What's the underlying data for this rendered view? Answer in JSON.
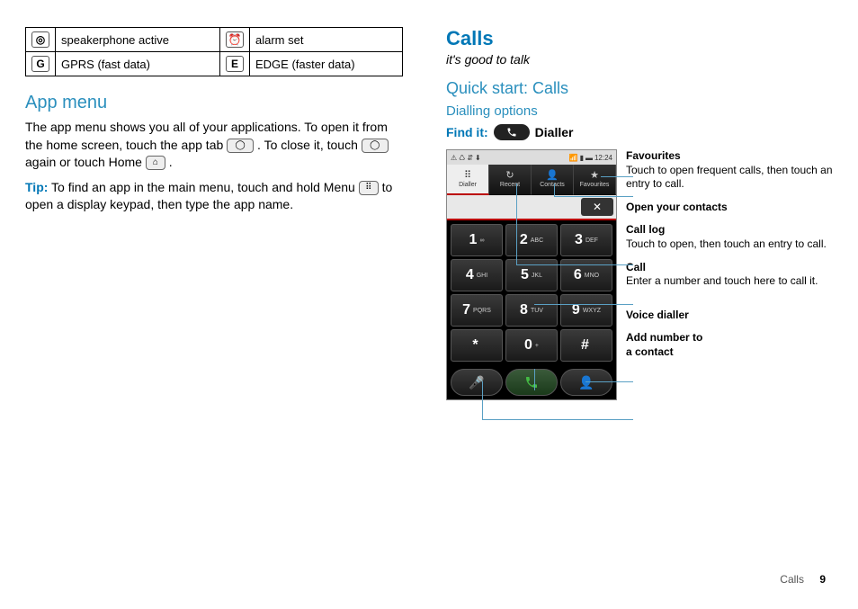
{
  "icon_table": {
    "rows": [
      {
        "icon1": "◎",
        "label1": "speakerphone active",
        "icon2": "⏰",
        "label2": "alarm set"
      },
      {
        "icon1": "G",
        "label1": "GPRS (fast data)",
        "icon2": "E",
        "label2": "EDGE (faster data)"
      }
    ]
  },
  "left": {
    "app_menu_title": "App menu",
    "app_menu_p1a": "The app menu shows you all of your applications. To open it from the home screen, touch the app tab ",
    "app_menu_p1b": ". To close it, touch ",
    "app_menu_p1c": " again or touch Home ",
    "app_menu_p1d": ".",
    "tip_label": "Tip:",
    "tip_text_a": " To find an app in the main menu, touch and hold Menu ",
    "tip_text_b": " to open a display keypad, then type the app name."
  },
  "right": {
    "calls_title": "Calls",
    "tagline": "it's good to talk",
    "quickstart": "Quick start: Calls",
    "dialling_options": "Dialling options",
    "find_it_label": "Find it:",
    "find_it_value": "Dialler",
    "status_time": "12:24",
    "tabs": [
      "Dialler",
      "Recent",
      "Contacts",
      "Favourites"
    ],
    "keys": [
      {
        "n": "1",
        "l": "∞"
      },
      {
        "n": "2",
        "l": "ABC"
      },
      {
        "n": "3",
        "l": "DEF"
      },
      {
        "n": "4",
        "l": "GHI"
      },
      {
        "n": "5",
        "l": "JKL"
      },
      {
        "n": "6",
        "l": "MNO"
      },
      {
        "n": "7",
        "l": "PQRS"
      },
      {
        "n": "8",
        "l": "TUV"
      },
      {
        "n": "9",
        "l": "WXYZ"
      },
      {
        "n": "*",
        "l": ""
      },
      {
        "n": "0",
        "l": "+"
      },
      {
        "n": "#",
        "l": ""
      }
    ],
    "callouts": {
      "favourites_label": "Favourites",
      "favourites_text": "Touch to open frequent calls, then touch an entry to call.",
      "open_contacts": "Open your contacts",
      "call_log_label": "Call log",
      "call_log_text": "Touch to open, then touch an entry to call.",
      "call_label": "Call",
      "call_text": "Enter a number and touch here to call it.",
      "voice_dialler": "Voice dialler",
      "add_number_label": "Add number to",
      "add_number_text": "a contact"
    }
  },
  "footer": {
    "section": "Calls",
    "page": "9"
  }
}
